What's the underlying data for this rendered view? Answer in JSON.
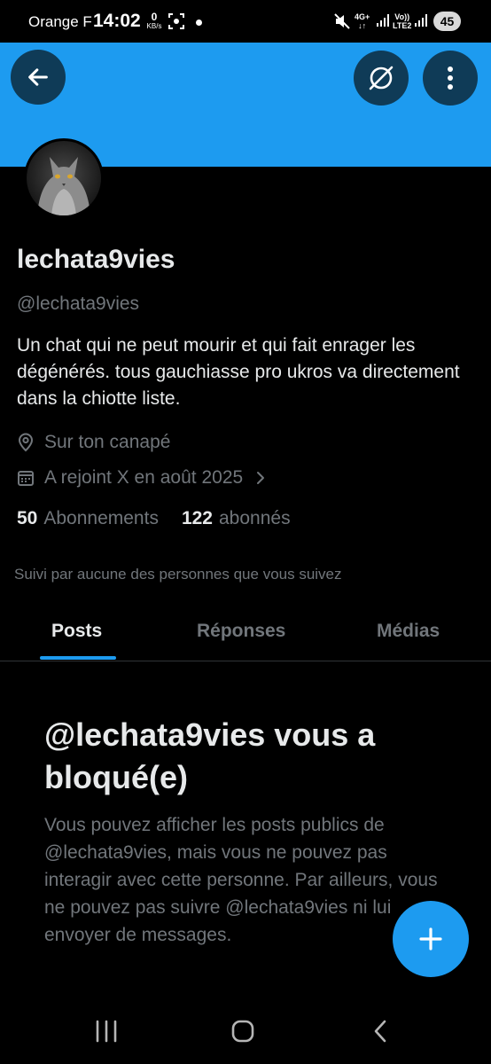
{
  "status_bar": {
    "carrier": "Orange F",
    "time": "14:02",
    "data_rate_value": "0",
    "data_rate_unit": "KB/s",
    "network_4g": "4G+",
    "volte_top": "Vo))",
    "volte_bottom": "LTE2",
    "battery": "45"
  },
  "header": {
    "back_icon": "arrow-left-icon",
    "grok_icon": "grok-icon",
    "more_icon": "more-vertical-icon",
    "banner_color": "#1d9bf0"
  },
  "profile": {
    "display_name": "lechata9vies",
    "handle": "@lechata9vies",
    "bio": "Un chat qui ne peut mourir et qui fait enrager les dégénérés. tous gauchiasse pro ukros va directement dans la chiotte liste.",
    "location": "Sur ton canapé",
    "joined": "A rejoint X en août 2025",
    "following_count": "50",
    "following_label": "Abonnements",
    "followers_count": "122",
    "followers_label": "abonnés",
    "followed_by": "Suivi par aucune des personnes que vous suivez"
  },
  "tabs": [
    {
      "label": "Posts",
      "active": true
    },
    {
      "label": "Réponses",
      "active": false
    },
    {
      "label": "Médias",
      "active": false
    }
  ],
  "blocked": {
    "title": "@lechata9vies vous a bloqué(e)",
    "body": "Vous pouvez afficher les posts publics de @lechata9vies, mais vous ne pouvez pas interagir avec cette personne. Par ailleurs, vous ne pouvez pas suivre @lechata9vies ni lui envoyer de messages."
  },
  "colors": {
    "accent": "#1d9bf0",
    "background": "#000000",
    "text_primary": "#e7e9ea",
    "text_secondary": "#71767b"
  }
}
